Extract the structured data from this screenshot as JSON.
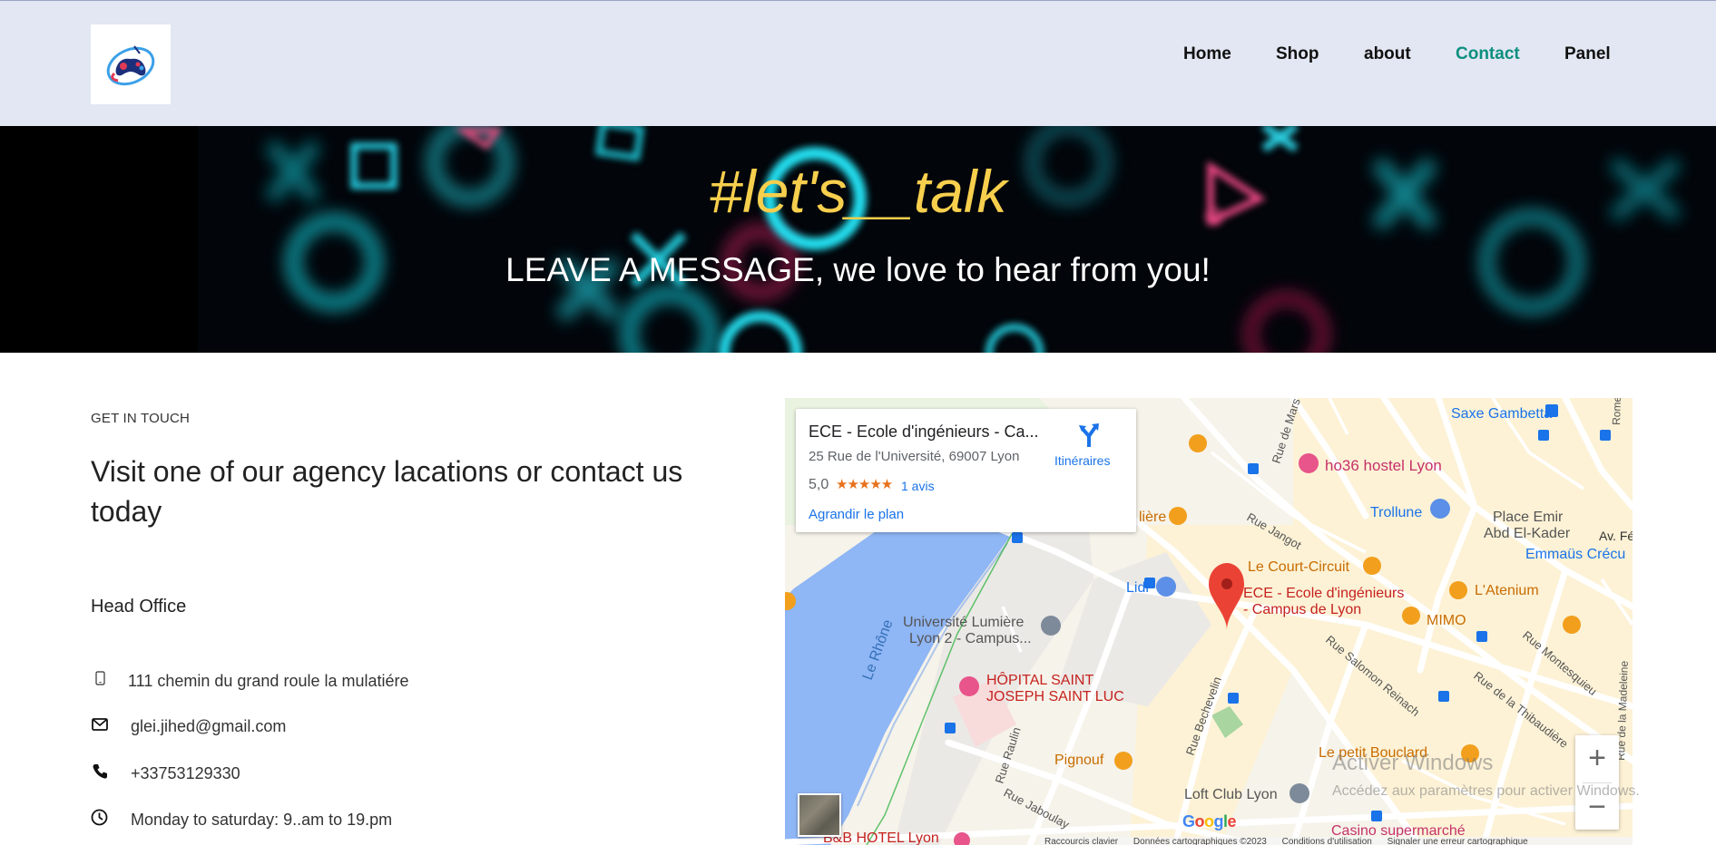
{
  "nav": {
    "items": [
      {
        "label": "Home",
        "active": false
      },
      {
        "label": "Shop",
        "active": false
      },
      {
        "label": "about",
        "active": false
      },
      {
        "label": "Contact",
        "active": true
      },
      {
        "label": "Panel",
        "active": false
      }
    ],
    "active_color": "#0d8f7f"
  },
  "hero": {
    "title": "#let's__talk",
    "subtitle": "LEAVE A MESSAGE, we love to hear from you!",
    "title_color": "#f7cf4d"
  },
  "contact": {
    "eyebrow": "GET IN TOUCH",
    "headline": "Visit one of our agency lacations or contact us today",
    "office_title": "Head Office",
    "address": "111 chemin du grand roule la mulatiére",
    "email": "glei.jihed@gmail.com",
    "phone": "+33753129330",
    "hours": "Monday to saturday: 9..am to 19.pm",
    "icons": [
      "mobile-icon",
      "envelope-icon",
      "phone-icon",
      "clock-icon"
    ]
  },
  "map": {
    "place_card": {
      "title": "ECE - Ecole d'ingénieurs - Ca...",
      "address": "25 Rue de l'Université, 69007 Lyon",
      "rating": "5,0",
      "stars": "★★★★★",
      "reviews": "1 avis",
      "enlarge": "Agrandir le plan",
      "directions": "Itinéraires"
    },
    "labels": {
      "saxe": "Saxe Gambetta",
      "hostel": "ho36 hostel Lyon",
      "trollune": "Trollune",
      "place_emir_1": "Place Emir",
      "place_emir_2": "Abd El-Kader",
      "av_fel": "Av. Fél",
      "emmaus": "Emmaüs Crécu",
      "court_circuit": "Le Court-Circuit",
      "latenium": "L'Atenium",
      "liere": "lière",
      "lidl": "Lidl",
      "ece_1": "ECE - Ecole d'ingénieurs",
      "ece_2": "- Campus de Lyon",
      "mimo": "MIMO",
      "univ_1": "Université Lumière",
      "univ_2": "Lyon 2 - Campus...",
      "rhone": "Le Rhône",
      "hopital_1": "HÔPITAL SAINT",
      "hopital_2": "JOSEPH SAINT LUC",
      "pignouf": "Pignouf",
      "loft": "Loft Club Lyon",
      "bouclard": "Le petit Bouclard",
      "casino": "Casino supermarché",
      "bb_hotel": "B&B HOTEL Lyon",
      "rue_marseille": "Rue de Mars",
      "rue_jangot": "Rue Jangot",
      "rue_salomon": "Rue Salomon Reinach",
      "rue_montesquieu": "Rue Montesquieu",
      "rue_thibaudiere": "Rue de la Thibaudière",
      "rue_madeleine": "Rue de la Madeleine",
      "rue_bechevelin": "Rue Bechevelin",
      "rue_raulin": "Rue Raulin",
      "rue_jaboulay": "Rue Jaboulay",
      "rue_rome": "Rome"
    },
    "zoom_in": "+",
    "zoom_out": "−",
    "google": "Google",
    "footer": [
      "Raccourcis clavier",
      "Données cartographiques ©2023",
      "Conditions d'utilisation",
      "Signaler une erreur cartographique"
    ]
  },
  "watermark": {
    "title": "Activer Windows",
    "subtitle": "Accédez aux paramètres pour activer Windows."
  }
}
